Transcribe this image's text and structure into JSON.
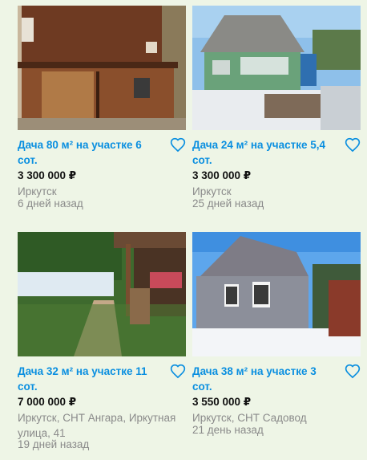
{
  "listings": [
    {
      "title": "Дача 80 м² на участке 6 сот.",
      "price": "3 300 000 ₽",
      "location": "Иркутск",
      "date": "6 дней назад"
    },
    {
      "title": "Дача 24 м² на участке 5,4 сот.",
      "price": "3 300 000 ₽",
      "location": "Иркутск",
      "date": "25 дней назад"
    },
    {
      "title": "Дача 32 м² на участке 11 сот.",
      "price": "7 000 000 ₽",
      "location": "Иркутск, СНТ Ангара, Иркутная улица, 41",
      "date": "19 дней назад"
    },
    {
      "title": "Дача 38 м² на участке 3 сот.",
      "price": "3 550 000 ₽",
      "location": "Иркутск, СНТ Садовод",
      "date": "21 день назад"
    }
  ],
  "icons": {
    "favorite": "heart-outline-icon"
  },
  "colors": {
    "title": "#0a8fe0",
    "price": "#111111",
    "meta": "#8a8a8a",
    "background": "#eef5e6"
  }
}
